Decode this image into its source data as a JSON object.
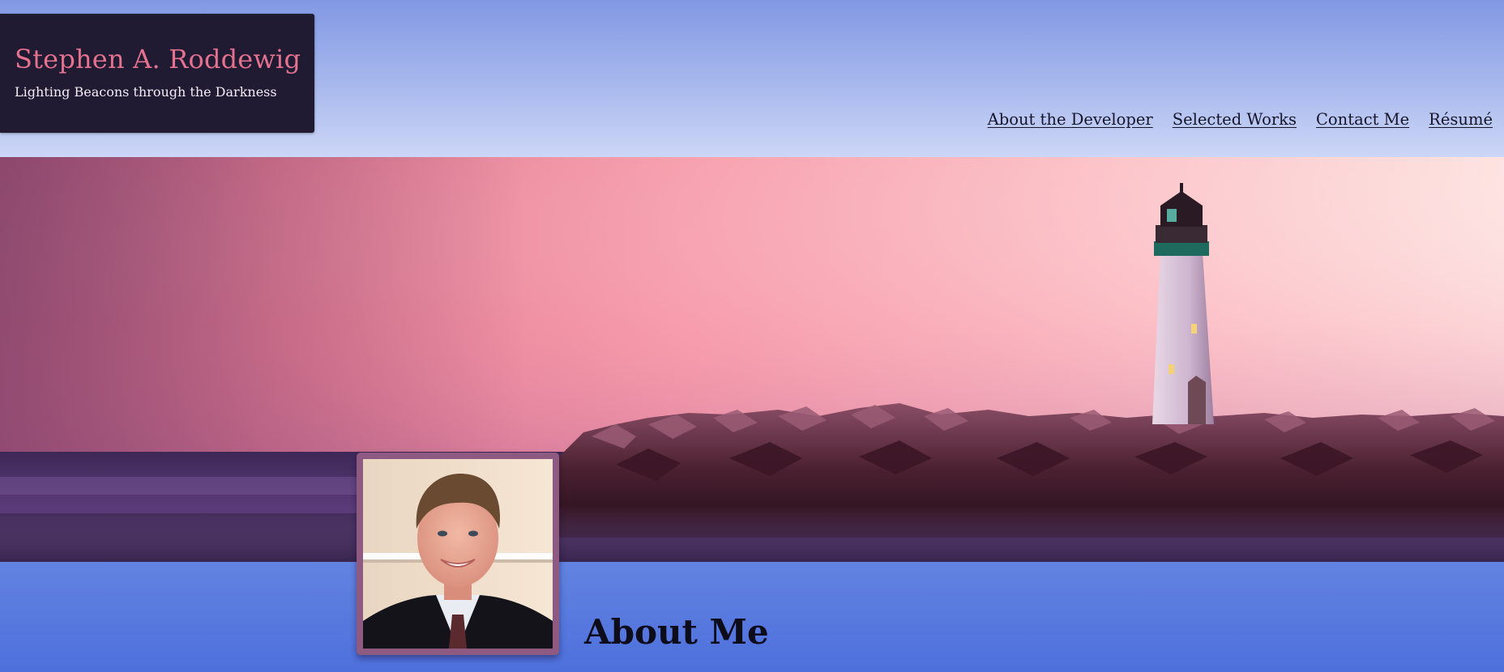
{
  "site": {
    "title": "Stephen A. Roddewig",
    "tagline": "Lighting Beacons through the Darkness"
  },
  "nav": {
    "items": [
      {
        "label": "About the Developer"
      },
      {
        "label": "Selected Works"
      },
      {
        "label": "Contact Me"
      },
      {
        "label": "Résumé"
      }
    ]
  },
  "hero": {
    "image": "lighthouse-on-rocky-jetty-at-sunset"
  },
  "about": {
    "heading": "About Me",
    "photo": "developer-portrait"
  },
  "colors": {
    "header_top": "#8198e3",
    "header_bottom": "#ccd6f6",
    "brand_box": "#201a33",
    "title_accent": "#e2728d",
    "nav_text": "#15152a",
    "content_band": "#5a7ae0",
    "photo_frame": "#8f5a82"
  }
}
